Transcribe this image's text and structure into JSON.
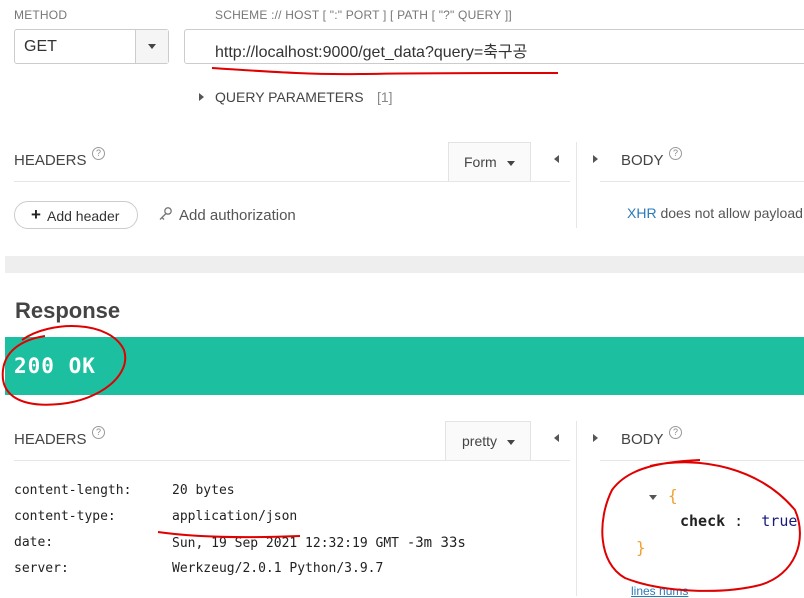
{
  "request": {
    "method_label": "METHOD",
    "method_value": "GET",
    "url_hint": "SCHEME :// HOST [ \":\" PORT ] [ PATH [ \"?\" QUERY ]]",
    "url_value": "http://localhost:9000/get_data?query=축구공",
    "query_params_label": "QUERY PARAMETERS",
    "query_params_count": "[1]",
    "headers_title": "HEADERS",
    "form_label": "Form",
    "add_header_label": "Add header",
    "add_authorization_label": "Add authorization",
    "body_title": "BODY",
    "xhr_link": "XHR",
    "xhr_note": " does not allow payload"
  },
  "response": {
    "title": "Response",
    "status": "200 OK",
    "headers_title": "HEADERS",
    "format_label": "pretty",
    "body_title": "BODY",
    "headers": [
      {
        "key": "content-length:",
        "value": "20 bytes"
      },
      {
        "key": "content-type:",
        "value": "application/json"
      },
      {
        "key": "date:",
        "value": "Sun, 19 Sep 2021 12:32:19 GMT",
        "extra": "-3m 33s"
      },
      {
        "key": "server:",
        "value": "Werkzeug/2.0.1 Python/3.9.7"
      }
    ],
    "json_open": "{",
    "json_key": "check",
    "json_sep": " :  ",
    "json_value": "true",
    "json_close": "}",
    "lines_nums_label": "lines nums"
  },
  "colors": {
    "status_bg": "#1cc0a0",
    "link": "#2a7ab8",
    "annotation": "#e00000",
    "json_brace": "#f0a030"
  }
}
